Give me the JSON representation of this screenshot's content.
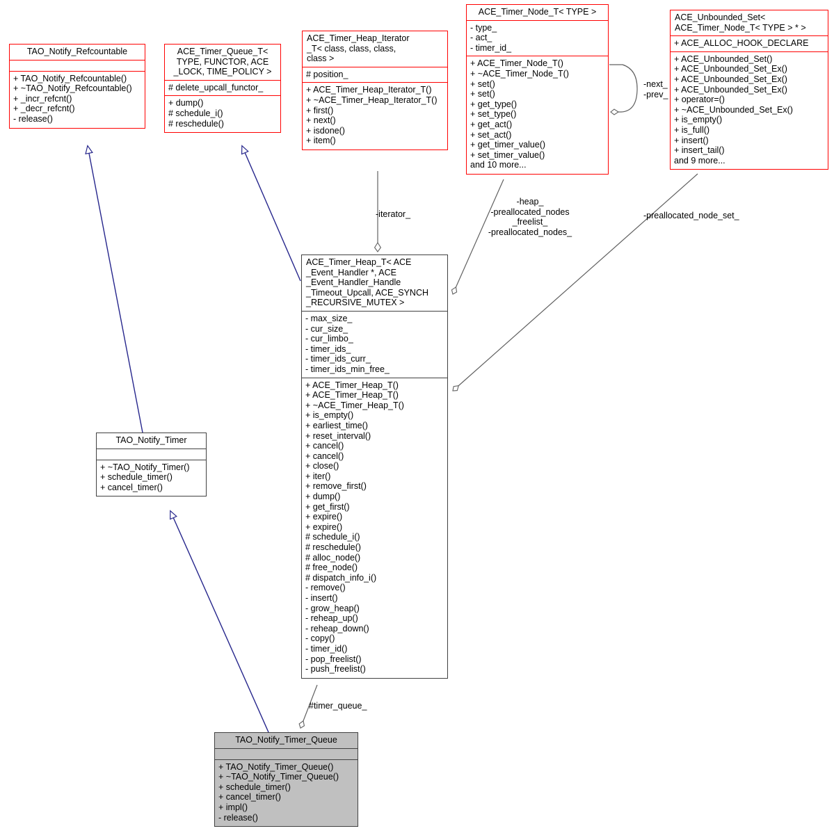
{
  "diagram": {
    "kind": "uml-class-collaboration-diagram",
    "colors": {
      "template_border": "#ff0000",
      "plain_border": "#404040",
      "highlight_fill": "#c0c0c0",
      "inherit_edge": "#26268c",
      "assoc_edge": "#606060",
      "background": "#ffffff"
    }
  },
  "nodes": [
    {
      "id": "tao_notify_refcountable",
      "title": "TAO_Notify_Refcountable",
      "attributes": [],
      "operations": [
        "+ TAO_Notify_Refcountable()",
        "+ ~TAO_Notify_Refcountable()",
        "+ _incr_refcnt()",
        "+ _decr_refcnt()",
        "- release()"
      ]
    },
    {
      "id": "ace_timer_queue_t",
      "title": "ACE_Timer_Queue_T<\n TYPE, FUNCTOR, ACE\n_LOCK, TIME_POLICY >",
      "attributes": [
        "# delete_upcall_functor_"
      ],
      "operations": [
        "+ dump()",
        "# schedule_i()",
        "# reschedule()"
      ]
    },
    {
      "id": "ace_timer_heap_iterator_t",
      "title": "ACE_Timer_Heap_Iterator\n_T< class, class, class,\n          class >",
      "attributes": [
        "# position_"
      ],
      "operations": [
        "+ ACE_Timer_Heap_Iterator_T()",
        "+ ~ACE_Timer_Heap_Iterator_T()",
        "+ first()",
        "+ next()",
        "+ isdone()",
        "+ item()"
      ]
    },
    {
      "id": "ace_timer_node_t",
      "title": "ACE_Timer_Node_T< TYPE >",
      "attributes": [
        "- type_",
        "- act_",
        "- timer_id_"
      ],
      "operations": [
        "+ ACE_Timer_Node_T()",
        "+ ~ACE_Timer_Node_T()",
        "+ set()",
        "+ set()",
        "+ get_type()",
        "+ set_type()",
        "+ get_act()",
        "+ set_act()",
        "+ get_timer_value()",
        "+ set_timer_value()",
        "and 10 more..."
      ]
    },
    {
      "id": "ace_unbounded_set",
      "title": "ACE_Unbounded_Set<\n ACE_Timer_Node_T< TYPE > * >",
      "attributes": [
        "+ ACE_ALLOC_HOOK_DECLARE"
      ],
      "operations": [
        "+ ACE_Unbounded_Set()",
        "+ ACE_Unbounded_Set_Ex()",
        "+ ACE_Unbounded_Set_Ex()",
        "+ ACE_Unbounded_Set_Ex()",
        "+ operator=()",
        "+ ~ACE_Unbounded_Set_Ex()",
        "+ is_empty()",
        "+ is_full()",
        "+ insert()",
        "+ insert_tail()",
        "and 9 more..."
      ]
    },
    {
      "id": "ace_timer_heap_t",
      "title": "ACE_Timer_Heap_T< ACE\n_Event_Handler *, ACE\n_Event_Handler_Handle\n_Timeout_Upcall, ACE_SYNCH\n   _RECURSIVE_MUTEX >",
      "attributes": [
        "- max_size_",
        "- cur_size_",
        "- cur_limbo_",
        "- timer_ids_",
        "- timer_ids_curr_",
        "- timer_ids_min_free_"
      ],
      "operations": [
        "+ ACE_Timer_Heap_T()",
        "+ ACE_Timer_Heap_T()",
        "+ ~ACE_Timer_Heap_T()",
        "+ is_empty()",
        "+ earliest_time()",
        "+ reset_interval()",
        "+ cancel()",
        "+ cancel()",
        "+ close()",
        "+ iter()",
        "+ remove_first()",
        "+ dump()",
        "+ get_first()",
        "+ expire()",
        "+ expire()",
        "# schedule_i()",
        "# reschedule()",
        "# alloc_node()",
        "# free_node()",
        "# dispatch_info_i()",
        "- remove()",
        "- insert()",
        "- grow_heap()",
        "- reheap_up()",
        "- reheap_down()",
        "- copy()",
        "- timer_id()",
        "- pop_freelist()",
        "- push_freelist()"
      ]
    },
    {
      "id": "tao_notify_timer",
      "title": "TAO_Notify_Timer",
      "attributes": [],
      "operations": [
        "+ ~TAO_Notify_Timer()",
        "+ schedule_timer()",
        "+ cancel_timer()"
      ]
    },
    {
      "id": "tao_notify_timer_queue",
      "title": "TAO_Notify_Timer_Queue",
      "attributes": [],
      "operations": [
        "+ TAO_Notify_Timer_Queue()",
        "+ ~TAO_Notify_Timer_Queue()",
        "+ schedule_timer()",
        "+ cancel_timer()",
        "+ impl()",
        "- release()"
      ]
    }
  ],
  "edge_labels": {
    "iterator": "-iterator_",
    "heap_nodes": "-heap_\n-preallocated_nodes\n_freelist_\n-preallocated_nodes_",
    "next_prev": "-next_\n-prev_",
    "node_set": "-preallocated_node_set_",
    "timer_queue": "#timer_queue_"
  }
}
